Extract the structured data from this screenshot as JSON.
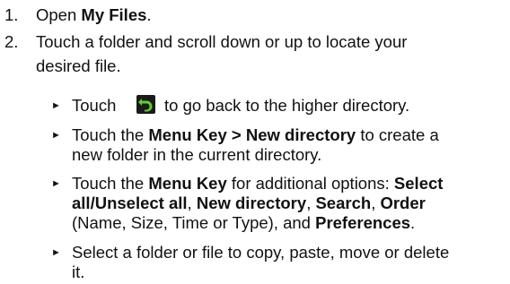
{
  "steps": [
    {
      "number": "1.",
      "pre": "Open ",
      "bold": "My Files",
      "post": "."
    },
    {
      "number": "2.",
      "line1": "Touch a folder and scroll down or up to locate your",
      "line2": "desired file."
    }
  ],
  "bullets": {
    "b1": {
      "pre": "Touch",
      "post": "to go back to the higher directory.",
      "icon": "green-back-arrow-icon"
    },
    "b2": {
      "line1_pre": "Touch the ",
      "line1_bold": "Menu Key > New directory",
      "line1_post": " to create a",
      "line2": "new folder in the current directory."
    },
    "b3": {
      "line1_pre": "Touch the ",
      "line1_bold1": "Menu Key",
      "line1_mid": " for additional options: ",
      "line1_bold2": "Select",
      "line2_bold1": "all/Unselect all",
      "line2_sep1": ", ",
      "line2_bold2": "New directory",
      "line2_sep2": ", ",
      "line2_bold3": "Search",
      "line2_sep3": ", ",
      "line2_bold4": "Order",
      "line3_pre": "(Name, Size, Time or Type), and ",
      "line3_bold": "Preferences",
      "line3_post": "."
    },
    "b4": {
      "line1": "Select a folder or file to copy, paste, move or delete",
      "line2": "it."
    }
  },
  "colors": {
    "text": "#111111",
    "icon_background": "#1a1a1a",
    "icon_arrow": "#5fcf2a"
  }
}
